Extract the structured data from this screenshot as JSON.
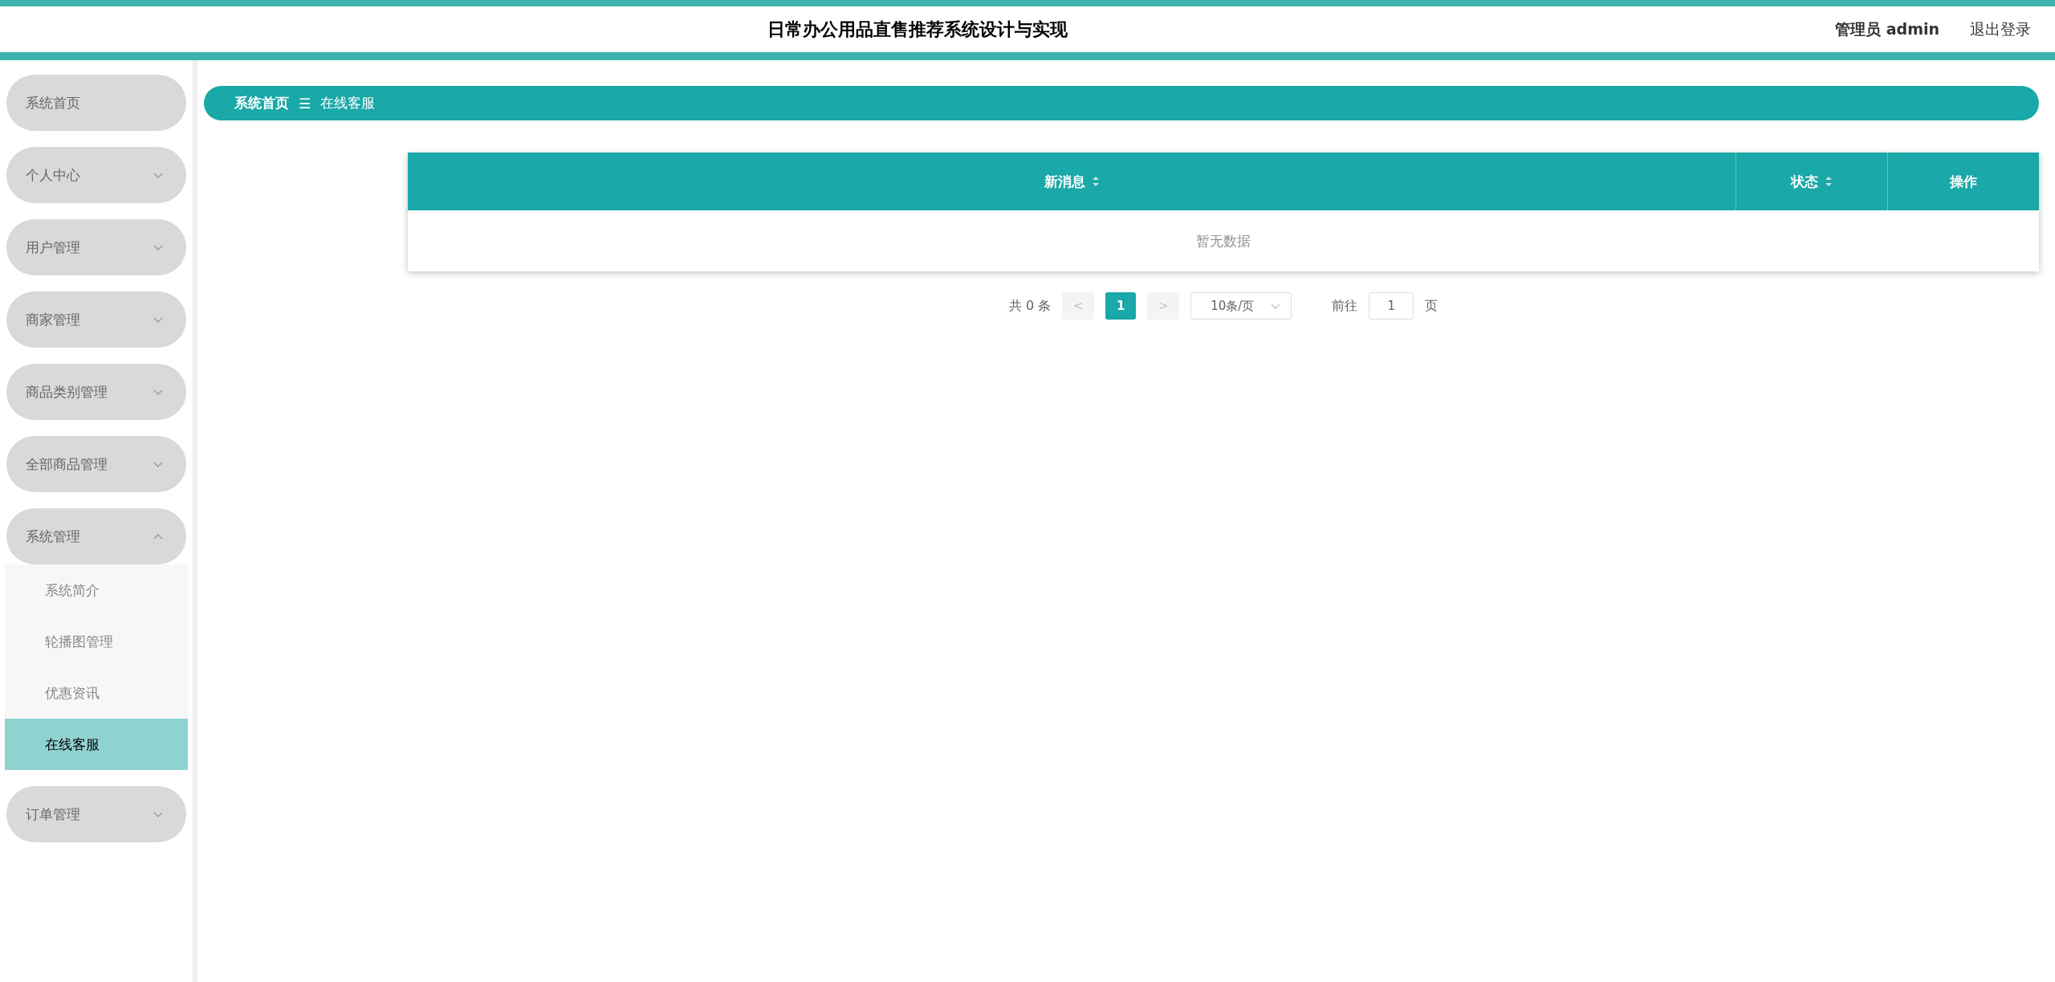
{
  "header": {
    "title": "日常办公用品直售推荐系统设计与实现",
    "user": "管理员 admin",
    "logout": "退出登录"
  },
  "sidebar": {
    "items": [
      {
        "label": "系统首页",
        "expandable": false
      },
      {
        "label": "个人中心",
        "expandable": true,
        "expanded": false
      },
      {
        "label": "用户管理",
        "expandable": true,
        "expanded": false
      },
      {
        "label": "商家管理",
        "expandable": true,
        "expanded": false
      },
      {
        "label": "商品类别管理",
        "expandable": true,
        "expanded": false
      },
      {
        "label": "全部商品管理",
        "expandable": true,
        "expanded": false
      },
      {
        "label": "系统管理",
        "expandable": true,
        "expanded": true,
        "children": [
          {
            "label": "系统简介",
            "selected": false
          },
          {
            "label": "轮播图管理",
            "selected": false
          },
          {
            "label": "优惠资讯",
            "selected": false
          },
          {
            "label": "在线客服",
            "selected": true
          }
        ]
      },
      {
        "label": "订单管理",
        "expandable": true,
        "expanded": false
      }
    ]
  },
  "breadcrumb": {
    "home": "系统首页",
    "separator": "☰",
    "current": "在线客服"
  },
  "table": {
    "columns": [
      {
        "label": "新消息",
        "sortable": true
      },
      {
        "label": "状态",
        "sortable": true
      },
      {
        "label": "操作",
        "sortable": false
      }
    ],
    "empty_text": "暂无数据"
  },
  "pagination": {
    "total": "共 0 条",
    "prev": "<",
    "pages": [
      {
        "label": "1",
        "selected": true
      }
    ],
    "next": ">",
    "page_size": "10条/页",
    "goto_label": "前往",
    "goto_value": "1",
    "goto_unit": "页"
  }
}
